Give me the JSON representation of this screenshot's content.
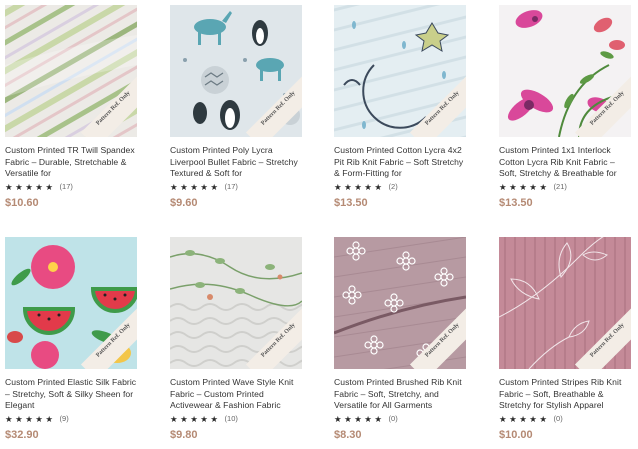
{
  "ribbon_label": "Pattern Ref. Only",
  "star_icon": "star-icon",
  "products": [
    {
      "title": "Custom Printed TR Twill Spandex Fabric – Durable, Stretchable & Versatile for",
      "stars": "★★★★★",
      "count": "(17)",
      "price": "$10.60"
    },
    {
      "title": "Custom Printed Poly Lycra Liverpool Bullet Fabric – Stretchy Textured & Soft for",
      "stars": "★★★★★",
      "count": "(17)",
      "price": "$9.60"
    },
    {
      "title": "Custom Printed Cotton Lycra 4x2 Pit Rib Knit Fabric – Soft Stretchy & Form-Fitting for",
      "stars": "★★★★★",
      "count": "(2)",
      "price": "$13.50"
    },
    {
      "title": "Custom Printed 1x1 Interlock Cotton Lycra Rib Knit Fabric – Soft, Stretchy & Breathable for",
      "stars": "★★★★★",
      "count": "(21)",
      "price": "$13.50"
    },
    {
      "title": "Custom Printed Elastic Silk Fabric – Stretchy, Soft & Silky Sheen for Elegant",
      "stars": "★★★★★",
      "count": "(9)",
      "price": "$32.90"
    },
    {
      "title": "Custom Printed Wave Style Knit Fabric – Custom Printed Activewear & Fashion Fabric",
      "stars": "★★★★★",
      "count": "(10)",
      "price": "$9.80"
    },
    {
      "title": "Custom Printed Brushed Rib Knit Fabric – Soft, Stretchy, and Versatile for All Garments",
      "stars": "★★★★★",
      "count": "(0)",
      "price": "$8.30"
    },
    {
      "title": "Custom Printed Stripes Rib Knit Fabric – Soft, Breathable & Stretchy for Stylish Apparel",
      "stars": "★★★★★",
      "count": "(0)",
      "price": "$10.00"
    }
  ]
}
